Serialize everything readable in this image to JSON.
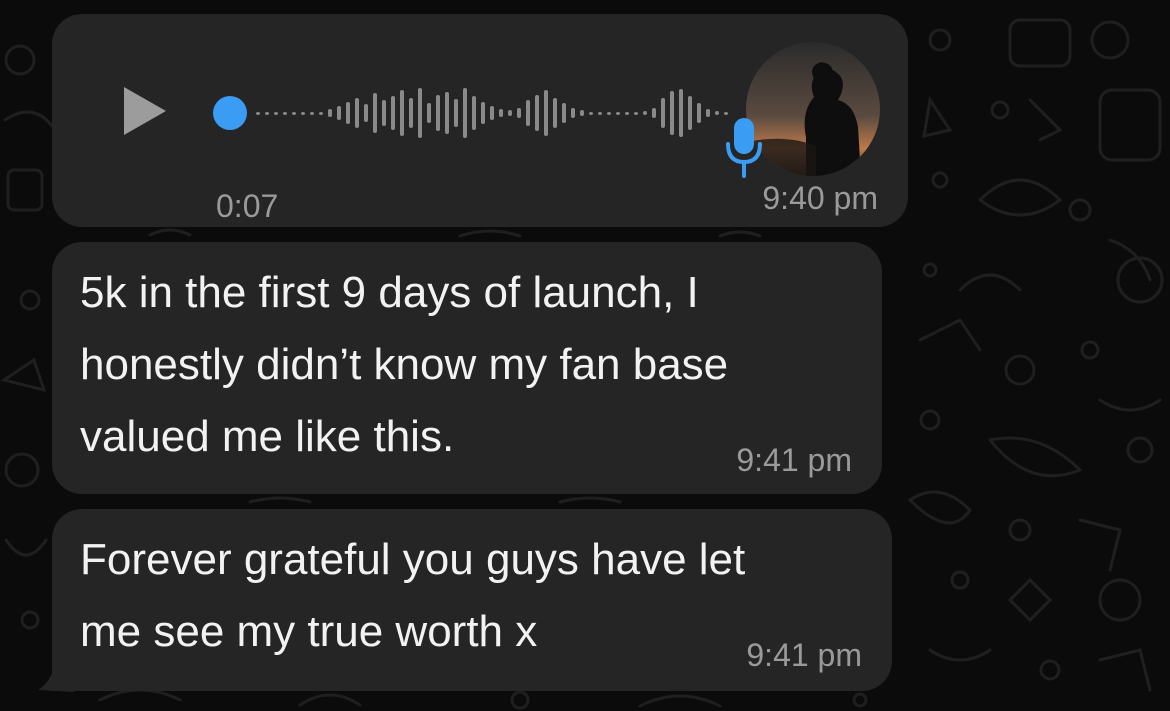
{
  "chat": {
    "voice_message": {
      "duration": "0:07",
      "time": "9:40 pm",
      "progress": 0.0,
      "icons": [
        "play-icon",
        "microphone-icon"
      ]
    },
    "messages": [
      {
        "text": "5k in the first 9 days of launch, I\nhonestly didn’t know my fan base\nvalued me like this.",
        "time": "9:41 pm"
      },
      {
        "text": "Forever grateful you guys have let\nme see my true worth x",
        "time": "9:41 pm"
      }
    ]
  },
  "colors": {
    "background": "#0b0b0b",
    "bubble": "#252525",
    "accent": "#3b9cf4",
    "text": "#f2f2f2",
    "meta_text": "#9a9a9a"
  }
}
